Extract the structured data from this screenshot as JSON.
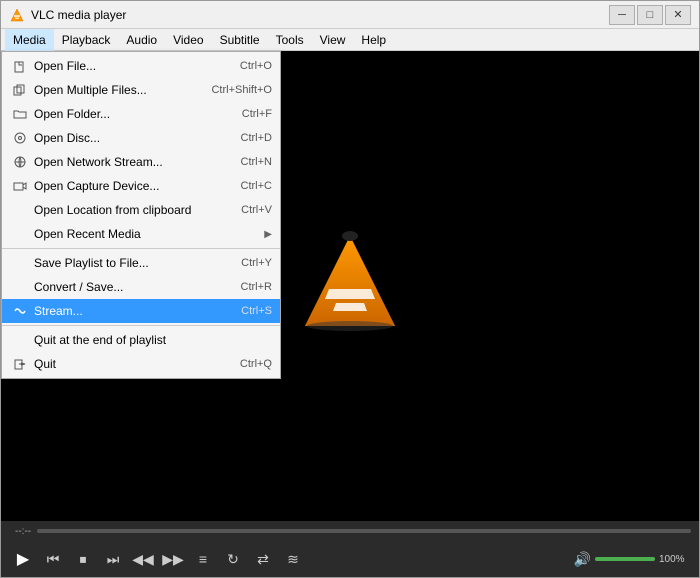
{
  "window": {
    "title": "VLC media player",
    "min_label": "─",
    "max_label": "□",
    "close_label": "✕"
  },
  "menubar": {
    "items": [
      {
        "id": "media",
        "label": "Media",
        "active": true
      },
      {
        "id": "playback",
        "label": "Playback"
      },
      {
        "id": "audio",
        "label": "Audio"
      },
      {
        "id": "video",
        "label": "Video"
      },
      {
        "id": "subtitle",
        "label": "Subtitle"
      },
      {
        "id": "tools",
        "label": "Tools"
      },
      {
        "id": "view",
        "label": "View"
      },
      {
        "id": "help",
        "label": "Help"
      }
    ]
  },
  "media_menu": {
    "items": [
      {
        "id": "open-file",
        "label": "Open File...",
        "shortcut": "Ctrl+O",
        "icon": "📄",
        "separator_after": false
      },
      {
        "id": "open-multiple",
        "label": "Open Multiple Files...",
        "shortcut": "Ctrl+Shift+O",
        "icon": "📂",
        "separator_after": false
      },
      {
        "id": "open-folder",
        "label": "Open Folder...",
        "shortcut": "Ctrl+F",
        "icon": "📁",
        "separator_after": false
      },
      {
        "id": "open-disc",
        "label": "Open Disc...",
        "shortcut": "Ctrl+D",
        "icon": "💿",
        "separator_after": false
      },
      {
        "id": "open-network",
        "label": "Open Network Stream...",
        "shortcut": "Ctrl+N",
        "icon": "🌐",
        "separator_after": false
      },
      {
        "id": "open-capture",
        "label": "Open Capture Device...",
        "shortcut": "Ctrl+C",
        "icon": "📹",
        "separator_after": false
      },
      {
        "id": "open-location",
        "label": "Open Location from clipboard",
        "shortcut": "Ctrl+V",
        "icon": "",
        "separator_after": false
      },
      {
        "id": "open-recent",
        "label": "Open Recent Media",
        "shortcut": "",
        "icon": "",
        "arrow": "▶",
        "separator_after": true
      },
      {
        "id": "save-playlist",
        "label": "Save Playlist to File...",
        "shortcut": "Ctrl+Y",
        "icon": "",
        "separator_after": false
      },
      {
        "id": "convert-save",
        "label": "Convert / Save...",
        "shortcut": "Ctrl+R",
        "icon": "",
        "separator_after": false
      },
      {
        "id": "stream",
        "label": "Stream...",
        "shortcut": "Ctrl+S",
        "icon": "stream",
        "highlighted": true,
        "separator_after": true
      },
      {
        "id": "quit-end",
        "label": "Quit at the end of playlist",
        "shortcut": "",
        "icon": "",
        "separator_after": false
      },
      {
        "id": "quit",
        "label": "Quit",
        "shortcut": "Ctrl+Q",
        "icon": ""
      }
    ]
  },
  "controls": {
    "play_label": "▶",
    "prev_label": "⏮",
    "stop_label": "⏹",
    "next_label": "⏭",
    "rewind_label": "◀◀",
    "forward_label": "▶▶",
    "toggle_playlist_label": "≡",
    "loop_label": "↻",
    "shuffle_label": "⇄",
    "extended_label": "≋",
    "volume_icon": "🔊",
    "volume_pct": "100%",
    "timeline_pos": "--:--"
  }
}
